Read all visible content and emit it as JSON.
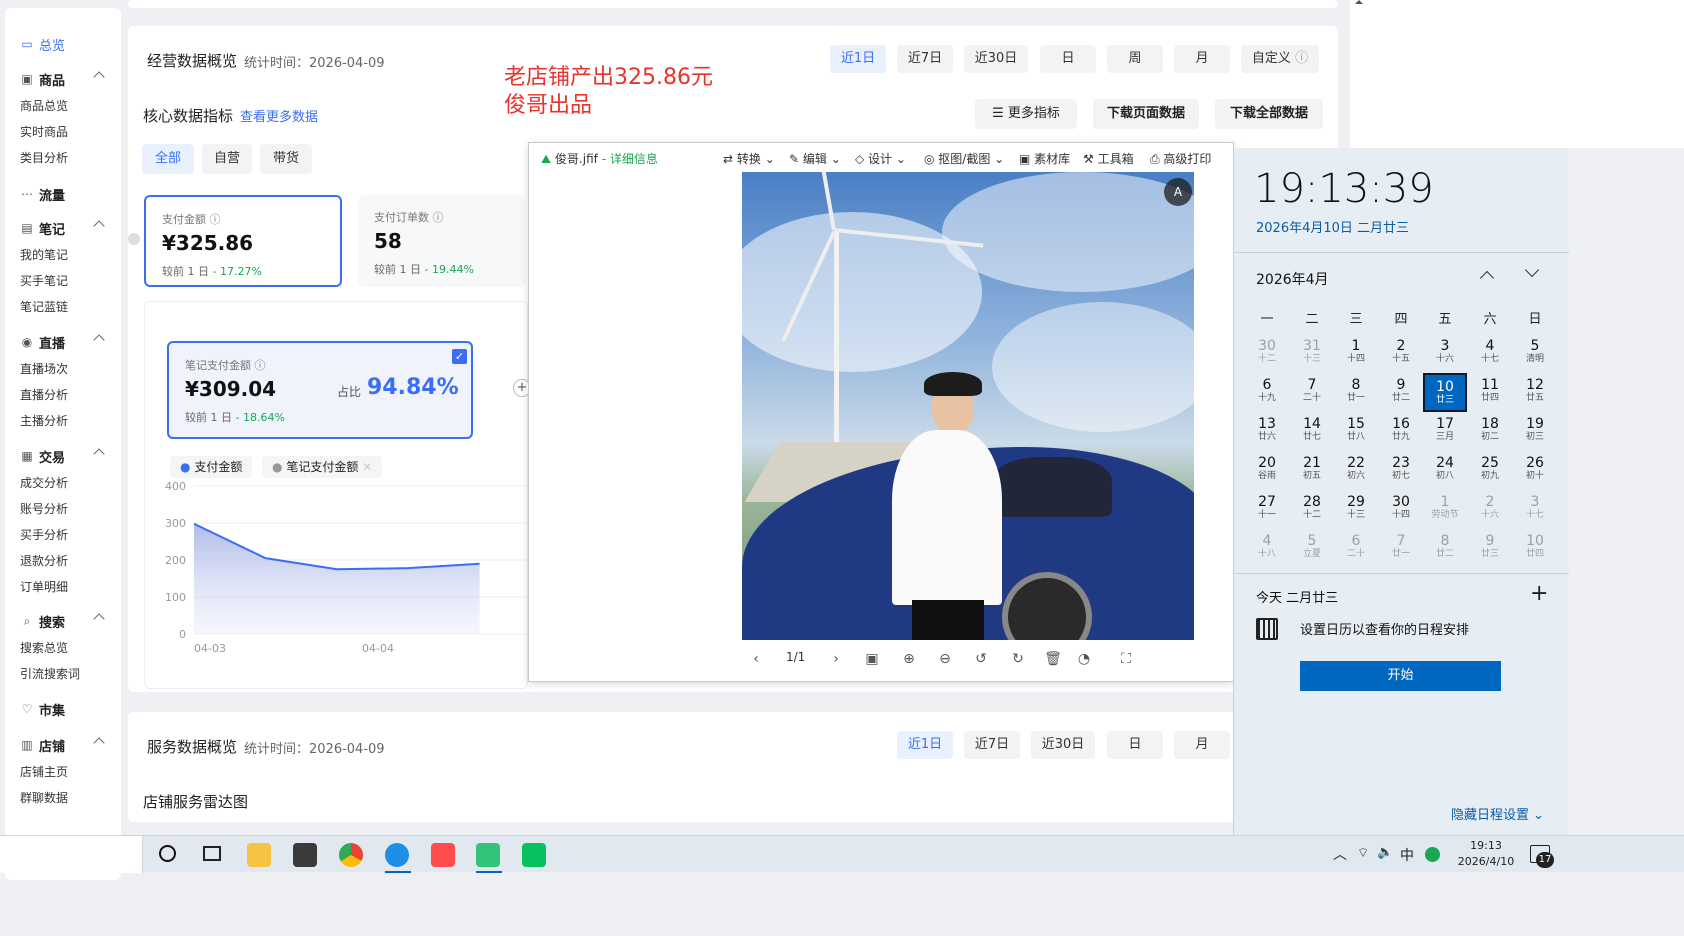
{
  "sidebar": {
    "items": [
      {
        "label": "总览",
        "icon": "monitor-icon",
        "active": true
      },
      {
        "label": "商品",
        "icon": "box-icon",
        "subs": [
          "商品总览",
          "实时商品",
          "类目分析"
        ]
      },
      {
        "label": "流量",
        "icon": "share-icon",
        "subs": []
      },
      {
        "label": "笔记",
        "icon": "note-icon",
        "subs": [
          "我的笔记",
          "买手笔记",
          "笔记蓝链"
        ]
      },
      {
        "label": "直播",
        "icon": "live-icon",
        "subs": [
          "直播场次",
          "直播分析",
          "主播分析"
        ]
      },
      {
        "label": "交易",
        "icon": "trade-icon",
        "subs": [
          "成交分析",
          "账号分析",
          "买手分析",
          "退款分析",
          "订单明细"
        ]
      },
      {
        "label": "搜索",
        "icon": "search-icon",
        "subs": [
          "搜索总览",
          "引流搜索词"
        ]
      },
      {
        "label": "市集",
        "icon": "market-icon",
        "subs": []
      },
      {
        "label": "店铺",
        "icon": "shop-icon",
        "subs": [
          "店铺主页",
          "群聊数据"
        ]
      }
    ]
  },
  "overview": {
    "title": "经营数据概览",
    "stat_time": "统计时间：2026-04-09",
    "date_buttons": [
      "近1日",
      "近7日",
      "近30日",
      "日",
      "周",
      "月",
      "自定义"
    ],
    "watermark_line1": "老店铺产出325.86元",
    "watermark_line2": "俊哥出品",
    "core_title": "核心数据指标",
    "more_data_link": "查看更多数据",
    "more_metrics": "更多指标",
    "download_page": "下载页面数据",
    "download_all": "下载全部数据",
    "tabs": [
      "全部",
      "自营",
      "带货"
    ],
    "cards": [
      {
        "label": "支付金额",
        "value": "¥325.86",
        "cmp_prefix": "较前 1 日",
        "cmp": "- 17.27%"
      },
      {
        "label": "支付订单数",
        "value": "58",
        "cmp_prefix": "较前 1 日",
        "cmp": "- 19.44%"
      }
    ],
    "note_card": {
      "label": "笔记支付金额",
      "value": "¥309.04",
      "share_label": "占比",
      "share_value": "94.84%",
      "cmp_prefix": "较前 1 日",
      "cmp": "- 18.64%"
    },
    "legend": [
      "支付金额",
      "笔记支付金额"
    ]
  },
  "chart_data": {
    "type": "area",
    "title": "",
    "xlabel": "",
    "ylabel": "",
    "ylim": [
      0,
      400
    ],
    "yticks": [
      0,
      100,
      200,
      300,
      400
    ],
    "x": [
      "04-03",
      "04-04"
    ],
    "series": [
      {
        "name": "支付金额",
        "values": [
          298,
          205,
          175,
          178,
          190
        ]
      }
    ]
  },
  "service": {
    "title": "服务数据概览",
    "stat_time": "统计时间：2026-04-09",
    "date_buttons": [
      "近1日",
      "近7日",
      "近30日",
      "日",
      "月"
    ],
    "radar_title": "店铺服务雷达图"
  },
  "viewer": {
    "filename": "俊哥.jfif",
    "detail": "- 详细信息",
    "toolbar": [
      "转换",
      "编辑",
      "设计",
      "抠图/截图",
      "素材库",
      "工具箱",
      "高级打印"
    ],
    "page": "1/1"
  },
  "calendar": {
    "time": "19:13:39",
    "date_line": "2026年4月10日 二月廿三",
    "month": "2026年4月",
    "weekdays": [
      "一",
      "二",
      "三",
      "四",
      "五",
      "六",
      "日"
    ],
    "days": [
      [
        "30",
        "十二",
        1
      ],
      [
        "31",
        "十三",
        1
      ],
      [
        "1",
        "十四",
        0
      ],
      [
        "2",
        "十五",
        0
      ],
      [
        "3",
        "十六",
        0
      ],
      [
        "4",
        "十七",
        0
      ],
      [
        "5",
        "清明",
        0
      ],
      [
        "6",
        "十九",
        0
      ],
      [
        "7",
        "二十",
        0
      ],
      [
        "8",
        "廿一",
        0
      ],
      [
        "9",
        "廿二",
        0
      ],
      [
        "10",
        "廿三",
        2
      ],
      [
        "11",
        "廿四",
        0
      ],
      [
        "12",
        "廿五",
        0
      ],
      [
        "13",
        "廿六",
        0
      ],
      [
        "14",
        "廿七",
        0
      ],
      [
        "15",
        "廿八",
        0
      ],
      [
        "16",
        "廿九",
        0
      ],
      [
        "17",
        "三月",
        0
      ],
      [
        "18",
        "初二",
        0
      ],
      [
        "19",
        "初三",
        0
      ],
      [
        "20",
        "谷雨",
        0
      ],
      [
        "21",
        "初五",
        0
      ],
      [
        "22",
        "初六",
        0
      ],
      [
        "23",
        "初七",
        0
      ],
      [
        "24",
        "初八",
        0
      ],
      [
        "25",
        "初九",
        0
      ],
      [
        "26",
        "初十",
        0
      ],
      [
        "27",
        "十一",
        0
      ],
      [
        "28",
        "十二",
        0
      ],
      [
        "29",
        "十三",
        0
      ],
      [
        "30",
        "十四",
        0
      ],
      [
        "1",
        "劳动节",
        1
      ],
      [
        "2",
        "十六",
        1
      ],
      [
        "3",
        "十七",
        1
      ],
      [
        "4",
        "十八",
        1
      ],
      [
        "5",
        "立夏",
        1
      ],
      [
        "6",
        "二十",
        1
      ],
      [
        "7",
        "廿一",
        1
      ],
      [
        "8",
        "廿二",
        1
      ],
      [
        "9",
        "廿三",
        1
      ],
      [
        "10",
        "廿四",
        1
      ]
    ],
    "today_label": "今天 二月廿三",
    "agenda_hint": "设置日历以查看你的日程安排",
    "start_button": "开始",
    "hide_agenda": "隐藏日程设置"
  },
  "taskbar": {
    "ime": "中",
    "clock_time": "19:13",
    "clock_date": "2026/4/10",
    "notif_count": "17"
  },
  "colors": {
    "accent": "#3b6ef5",
    "green": "#1aa653",
    "watermark": "#e8322b",
    "win_blue": "#0067c0"
  }
}
